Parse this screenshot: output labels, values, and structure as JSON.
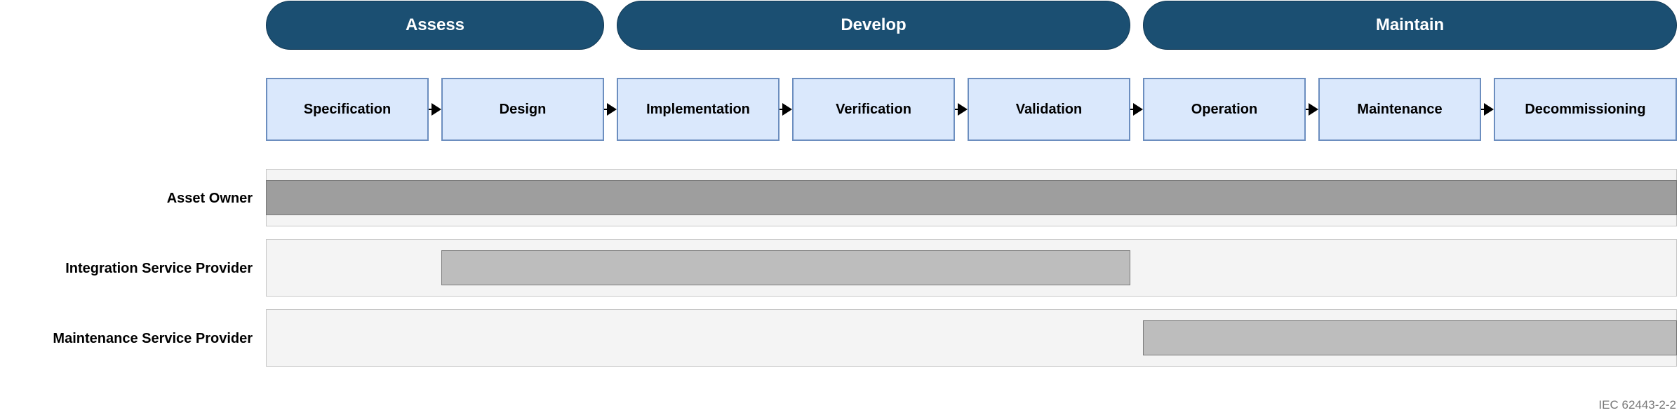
{
  "phases": [
    {
      "label": "Assess"
    },
    {
      "label": "Develop"
    },
    {
      "label": "Maintain"
    }
  ],
  "steps": [
    {
      "label": "Specification"
    },
    {
      "label": "Design"
    },
    {
      "label": "Implementation"
    },
    {
      "label": "Verification"
    },
    {
      "label": "Validation"
    },
    {
      "label": "Operation"
    },
    {
      "label": "Maintenance"
    },
    {
      "label": "Decommissioning"
    }
  ],
  "lanes": [
    {
      "label": "Asset Owner",
      "bar_color": "#9e9e9e"
    },
    {
      "label": "Integration Service Provider",
      "bar_color": "#bdbdbd"
    },
    {
      "label": "Maintenance Service Provider",
      "bar_color": "#bdbdbd"
    }
  ],
  "footer": "IEC 62443-2-2"
}
